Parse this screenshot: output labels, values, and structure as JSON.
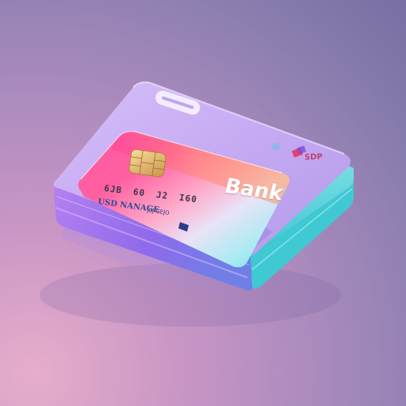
{
  "card": {
    "bank_name": "Bank",
    "number_groups": [
      "6JB",
      "60",
      "J2",
      "I60"
    ],
    "holder_name": "USD NANAGE",
    "expiry": "J0J GEJO",
    "issuer_logo_text": "SDP"
  },
  "colors": {
    "background": "#a98abd",
    "card_pink": "#ff4fa5",
    "card_cyan": "#63e0ea",
    "wallet_lavender": "#c3a6f2",
    "wallet_teal": "#3fd2d7",
    "chip_gold": "#e9c478"
  },
  "icons": {
    "chip": "emv-chip-icon",
    "card_slot": "card-slot-icon",
    "logo": "issuer-logo-icon"
  }
}
